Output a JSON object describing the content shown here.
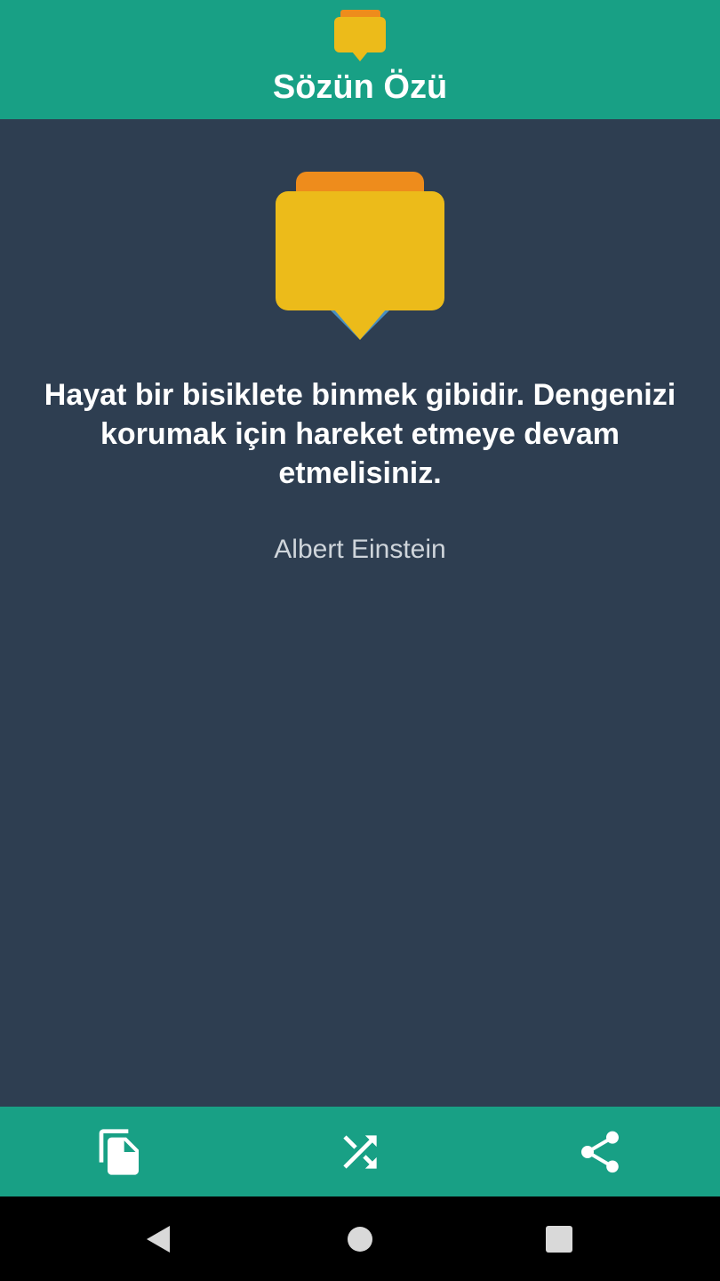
{
  "header": {
    "title": "Sözün Özü",
    "logo_icon": "speech-bubble-icon"
  },
  "quote": {
    "text": "Hayat bir bisiklete binmek gibidir. Dengenizi korumak için hareket etmeye devam etmelisiniz.",
    "author": "Albert Einstein"
  },
  "bottom_bar": {
    "actions": [
      {
        "icon": "copy-icon"
      },
      {
        "icon": "shuffle-icon"
      },
      {
        "icon": "share-icon"
      }
    ]
  },
  "system_nav": {
    "buttons": [
      {
        "icon": "back-icon"
      },
      {
        "icon": "home-icon"
      },
      {
        "icon": "recents-icon"
      }
    ]
  },
  "colors": {
    "accent": "#18a085",
    "background": "#2e3e51",
    "bubble_front": "#ecbb1a",
    "bubble_back": "#ee8c1c",
    "author_text": "#cfd5db"
  }
}
